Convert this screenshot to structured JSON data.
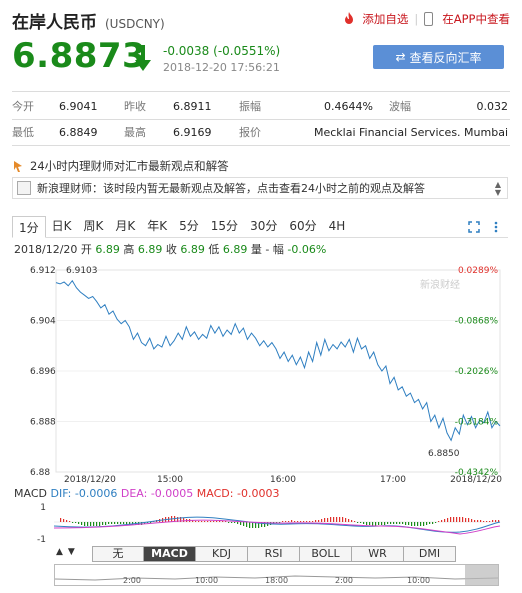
{
  "header": {
    "name": "在岸人民币",
    "code": "(USDCNY)",
    "add_favorite": "添加自选",
    "view_in_app": "在APP中查看"
  },
  "quote": {
    "price": "6.8873",
    "change": "-0.0038 (-0.0551%)",
    "time": "2018-12-20 17:56:21",
    "reverse_button": "查看反向汇率"
  },
  "stats": {
    "row1": [
      {
        "label": "今开",
        "value": "6.9041"
      },
      {
        "label": "昨收",
        "value": "6.8911"
      },
      {
        "label": "振幅",
        "value": "0.4644%"
      },
      {
        "label": "波幅",
        "value": "0.032"
      }
    ],
    "row2": [
      {
        "label": "最低",
        "value": "6.8849"
      },
      {
        "label": "最高",
        "value": "6.9169"
      },
      {
        "label": "报价",
        "value": "Mecklai Financial Services. Mumbai"
      }
    ]
  },
  "comments": {
    "heading": "24小时内理财师对汇市最新观点和解答",
    "message": "新浪理财师：该时段内暂无最新观点及解答，点击查看24小时之前的观点及解答"
  },
  "period_tabs": [
    "1分",
    "日K",
    "周K",
    "月K",
    "年K",
    "5分",
    "15分",
    "30分",
    "60分",
    "4H"
  ],
  "ohlc": {
    "date": "2018/12/20",
    "open_label": "开",
    "open": "6.89",
    "high_label": "高",
    "high": "6.89",
    "close_label": "收",
    "close": "6.89",
    "low_label": "低",
    "low": "6.89",
    "vol_label": "量",
    "vol": "-",
    "amp_label": "幅",
    "amp": "-0.06%"
  },
  "colors": {
    "up": "#e0302b",
    "down": "#1a8a1a",
    "line": "#2f7fc1",
    "accent": "#5b8fd6"
  },
  "chart_data": {
    "type": "line",
    "y_ticks": [
      "6.912",
      "6.904",
      "6.896",
      "6.888",
      "6.88"
    ],
    "pct_ticks": [
      "0.0289%",
      "-0.0868%",
      "-0.2026%",
      "-0.3184%",
      "-0.4342%"
    ],
    "x_ticks": [
      "2018/12/20",
      "15:00",
      "16:00",
      "17:00",
      "2018/12/20"
    ],
    "ylim": [
      6.88,
      6.912
    ],
    "high_label": "6.9103",
    "low_label": "6.8850",
    "watermark": "新浪财经",
    "values": [
      6.91,
      6.9098,
      6.9101,
      6.9095,
      6.9103,
      6.9092,
      6.9085,
      6.908,
      6.9075,
      6.9078,
      6.907,
      6.906,
      6.9065,
      6.905,
      6.9055,
      6.9042,
      6.9035,
      6.904,
      6.903,
      6.901,
      6.902,
      6.9005,
      6.9,
      6.9012,
      6.8995,
      6.9002,
      6.8998,
      6.9015,
      6.9,
      6.9008,
      6.902,
      6.901,
      6.903,
      6.9015,
      6.9022,
      6.901,
      6.9018,
      6.9012,
      6.9032,
      6.902,
      6.903,
      6.9015,
      6.9025,
      6.9018,
      6.9035,
      6.902,
      6.9028,
      6.901,
      6.902,
      6.9012,
      6.9,
      6.9008,
      6.8998,
      6.9005,
      6.8995,
      6.898,
      6.899,
      6.8975,
      6.8985,
      6.897,
      6.8982,
      6.8965,
      6.899,
      6.8975,
      6.9005,
      6.8985,
      6.901,
      6.8992,
      6.9002,
      6.8995,
      6.9006,
      6.8998,
      6.901,
      6.899,
      6.9012,
      6.8995,
      6.9,
      6.898,
      6.899,
      6.897,
      6.896,
      6.8968,
      6.894,
      6.895,
      6.893,
      6.8935,
      6.892,
      6.8925,
      6.891,
      6.8915,
      6.89,
      6.891,
      6.888,
      6.889,
      6.887,
      6.8885,
      6.8862,
      6.885,
      6.887,
      6.886,
      6.889,
      6.8875,
      6.8888,
      6.887,
      6.8882,
      6.8878,
      6.8895,
      6.887,
      6.888,
      6.8873
    ],
    "macd": {
      "dif_label": "DIF:",
      "dif": "-0.0006",
      "dea_label": "DEA:",
      "dea": "-0.0005",
      "macd_label": "MACD:",
      "macd": "-0.0003",
      "y_ticks": [
        "1",
        "-1"
      ],
      "title": "MACD"
    }
  },
  "indicator_tabs": [
    "无",
    "MACD",
    "KDJ",
    "RSI",
    "BOLL",
    "WR",
    "DMI"
  ],
  "overview_ticks": [
    "2:00",
    "10:00",
    "18:00",
    "2:00",
    "10:00"
  ]
}
